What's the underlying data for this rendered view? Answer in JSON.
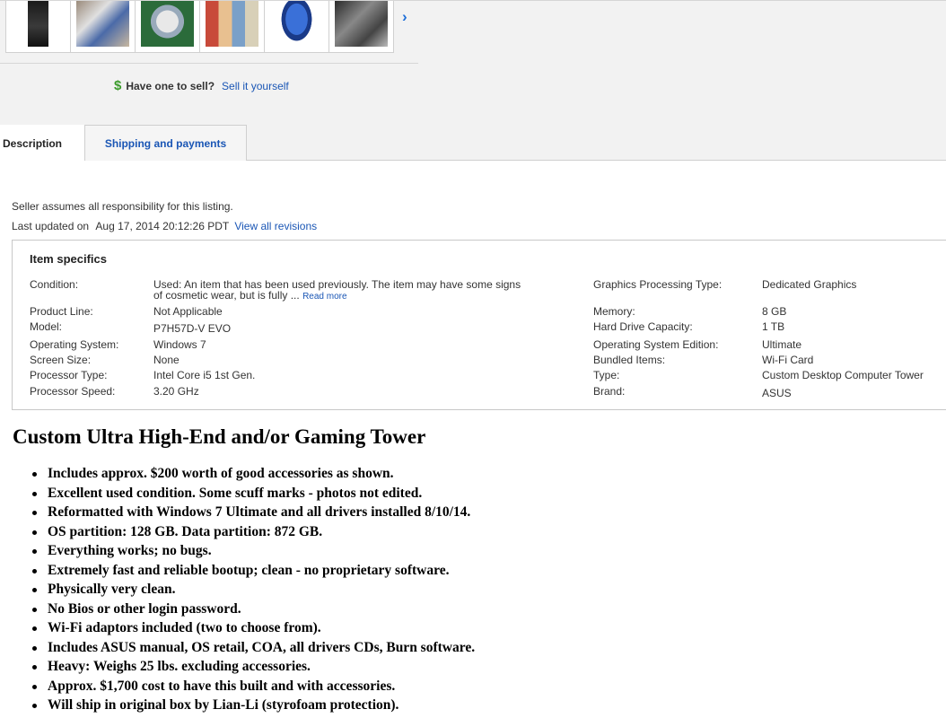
{
  "gallery": {
    "thumbnails": [
      "computer-tower-photo",
      "accessories-photo",
      "cd-photo",
      "software-boxes-photo",
      "mouse-photo",
      "motherboard-photo"
    ],
    "next_icon": "›"
  },
  "sell": {
    "icon": "$",
    "prompt": "Have one to sell?",
    "link": "Sell it yourself"
  },
  "tabs": [
    {
      "label": "Description",
      "active": true
    },
    {
      "label": "Shipping and payments",
      "active": false
    }
  ],
  "description": {
    "seller_note": "Seller assumes all responsibility for this listing.",
    "last_updated_label": "Last updated on",
    "last_updated_date": "Aug 17, 2014 20:12:26 PDT",
    "revisions_link": "View all revisions"
  },
  "item_specifics": {
    "title": "Item specifics",
    "condition_label": "Condition:",
    "condition_value": "Used: An item that has been used previously. The item may have some signs",
    "condition_value2": "of cosmetic wear, but is fully ...",
    "read_more": "Read more",
    "left": [
      {
        "label": "Product Line:",
        "value": "Not Applicable"
      },
      {
        "label": "Model:",
        "value": "P7H57D-V EVO"
      },
      {
        "label": "Operating System:",
        "value": "Windows 7"
      },
      {
        "label": "Screen Size:",
        "value": "None"
      },
      {
        "label": "Processor Type:",
        "value": "Intel Core i5 1st Gen."
      },
      {
        "label": "Processor Speed:",
        "value": "3.20 GHz"
      }
    ],
    "right_top": {
      "label": "Graphics Processing Type:",
      "value": "Dedicated Graphics"
    },
    "right": [
      {
        "label": "Memory:",
        "value": "8 GB"
      },
      {
        "label": "Hard Drive Capacity:",
        "value": "1 TB"
      },
      {
        "label": "Operating System Edition:",
        "value": "Ultimate"
      },
      {
        "label": "Bundled Items:",
        "value": "Wi-Fi Card"
      },
      {
        "label": "Type:",
        "value": "Custom Desktop Computer Tower"
      },
      {
        "label": "Brand:",
        "value": "ASUS"
      }
    ]
  },
  "listing": {
    "title": "Custom Ultra High-End and/or Gaming Tower",
    "bullets": [
      "Includes approx. $200 worth of good accessories as shown.",
      "Excellent used condition. Some scuff marks - photos not edited.",
      "Reformatted with Windows 7 Ultimate and all drivers installed 8/10/14.",
      "OS partition: 128 GB. Data partition: 872 GB.",
      "Everything works; no bugs.",
      "Extremely fast and reliable bootup; clean - no proprietary software.",
      "Physically very clean.",
      "No Bios or other login password.",
      "Wi-Fi adaptors included (two to choose from).",
      "Includes ASUS manual, OS retail, COA, all drivers CDs, Burn software.",
      "Heavy: Weighs 25 lbs. excluding accessories.",
      "Approx. $1,700 cost to have this built and with accessories.",
      "Will ship in original box by Lian-Li (styrofoam protection)."
    ]
  }
}
